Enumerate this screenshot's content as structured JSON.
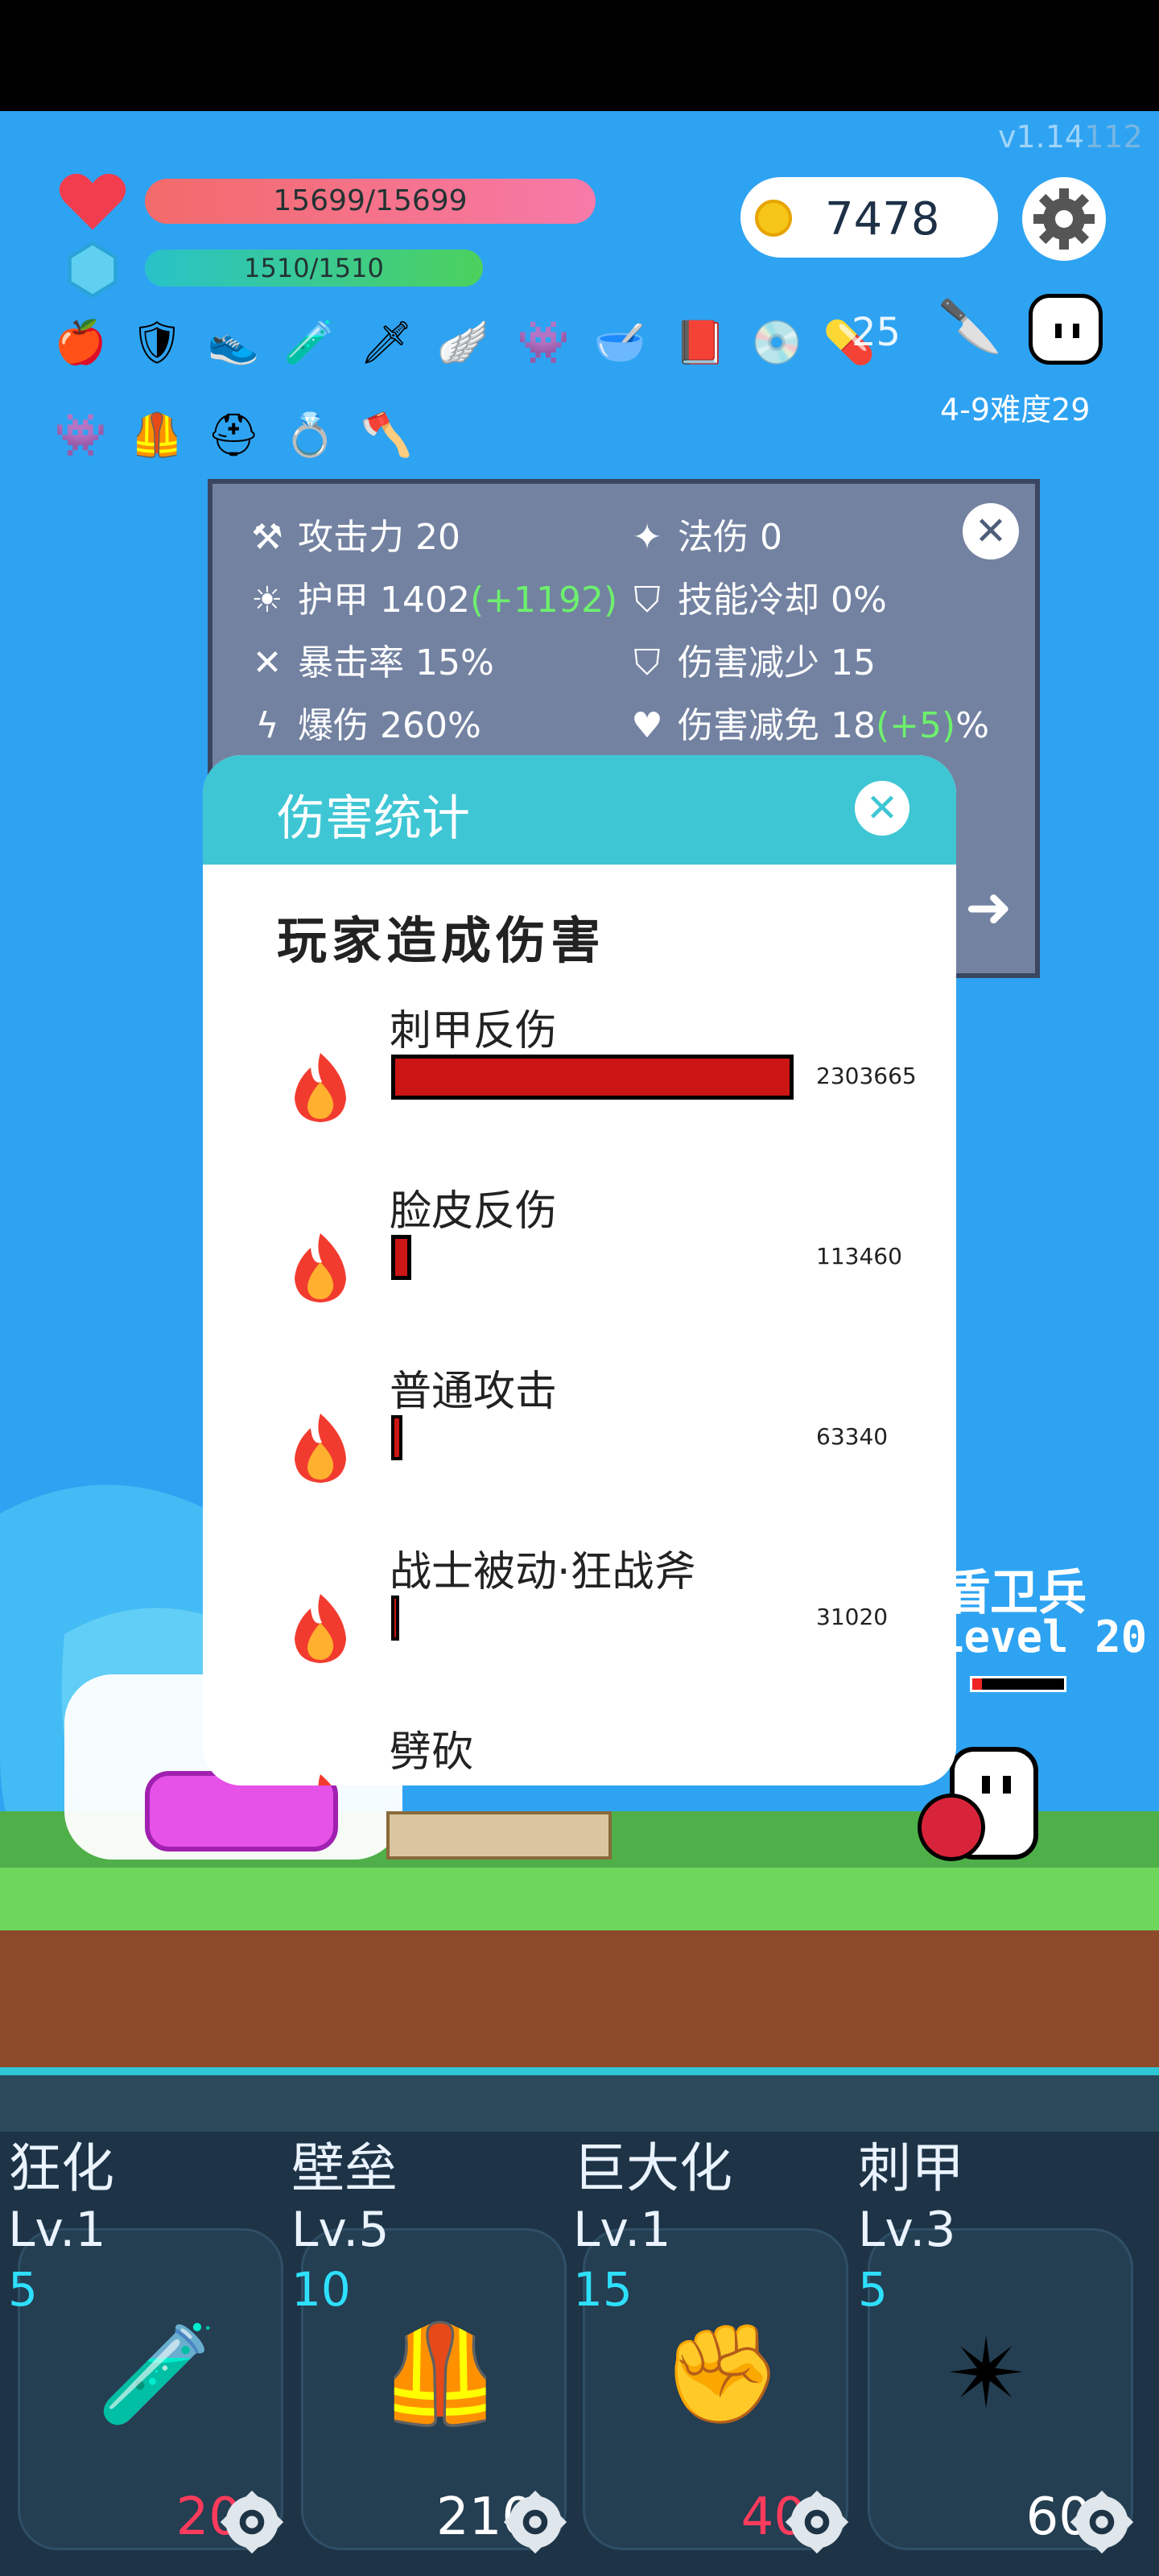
{
  "version": {
    "main": "v1.14",
    "build": "112"
  },
  "player": {
    "hp": "15699/15699",
    "mp": "1510/1510"
  },
  "gold": "7478",
  "item_count": "25",
  "stage": "4-9难度29",
  "items_row1": [
    "apple-icon",
    "shield-icon",
    "shoe-icon",
    "potion-icon",
    "sword-icon",
    "wing-icon",
    "slime-icon",
    "mortar-icon",
    "book-icon",
    "disc-icon",
    "pill-icon"
  ],
  "items_row2": [
    "slime-icon",
    "armor-icon",
    "helmet-icon",
    "ring-icon",
    "axe-icon"
  ],
  "stats": {
    "attack": {
      "label": "攻击力",
      "value": "20"
    },
    "magic": {
      "label": "法伤",
      "value": "0"
    },
    "armor": {
      "label": "护甲",
      "value": "1402",
      "bonus": "(+1192)"
    },
    "cooldown": {
      "label": "技能冷却",
      "value": "0%"
    },
    "crit_rate": {
      "label": "暴击率",
      "value": "15%"
    },
    "dmg_reduce": {
      "label": "伤害减少",
      "value": "15"
    },
    "crit_dmg": {
      "label": "爆伤",
      "value": "260%"
    },
    "dmg_immune": {
      "label": "伤害减免",
      "value": "18",
      "bonus": "(+5)",
      "unit": "%"
    }
  },
  "dialog": {
    "title": "伤害统计",
    "subtitle": "玩家造成伤害",
    "rows": [
      {
        "name": "刺甲反伤",
        "value": "2303665",
        "fraction": 1.0
      },
      {
        "name": "脸皮反伤",
        "value": "113460",
        "fraction": 0.049
      },
      {
        "name": "普通攻击",
        "value": "63340",
        "fraction": 0.027
      },
      {
        "name": "战士被动·狂战斧",
        "value": "31020",
        "fraction": 0.013
      },
      {
        "name": "劈砍",
        "value": "",
        "fraction": 0
      }
    ]
  },
  "enemy": {
    "name": "盾卫兵",
    "level": "Level 20"
  },
  "skills": [
    {
      "name": "狂化",
      "level": "Lv.1",
      "cost": "5",
      "price": "20",
      "price_color": "#ff3b5c",
      "icon": "potion-icon"
    },
    {
      "name": "壁垒",
      "level": "Lv.5",
      "cost": "10",
      "price": "210",
      "price_color": "#ffffff",
      "icon": "armor-icon"
    },
    {
      "name": "巨大化",
      "level": "Lv.1",
      "cost": "15",
      "price": "40",
      "price_color": "#ff3b5c",
      "icon": "fist-icon"
    },
    {
      "name": "刺甲",
      "level": "Lv.3",
      "cost": "5",
      "price": "60",
      "price_color": "#ffffff",
      "icon": "mace-icon"
    }
  ]
}
